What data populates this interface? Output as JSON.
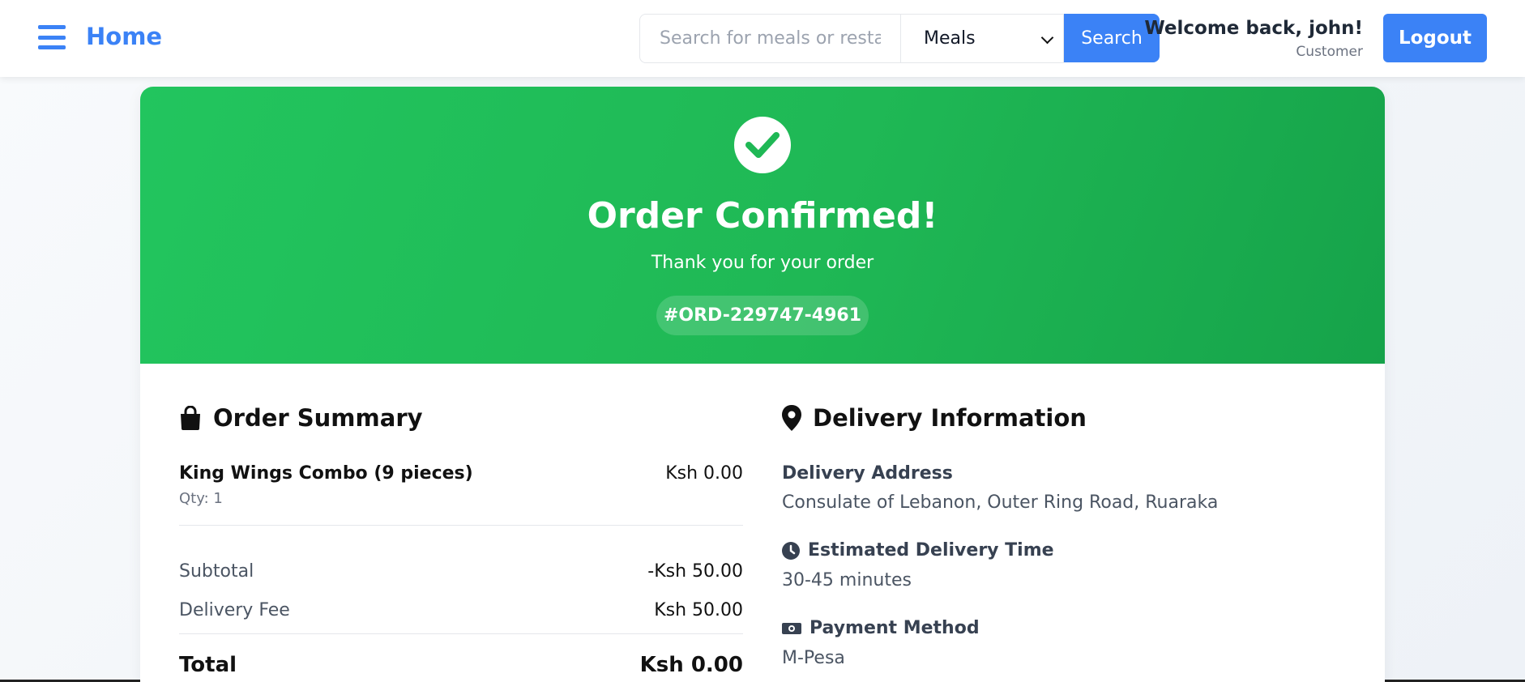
{
  "header": {
    "home_label": "Home",
    "search_placeholder": "Search for meals or restaurants",
    "category_selected": "Meals",
    "search_label": "Search",
    "welcome_text": "Welcome back, john!",
    "user_role": "Customer",
    "logout_label": "Logout"
  },
  "banner": {
    "title": "Order Confirmed!",
    "subtitle": "Thank you for your order",
    "order_number": "#ORD-229747-4961"
  },
  "order_summary": {
    "title": "Order Summary",
    "items": [
      {
        "name": "King Wings Combo (9 pieces)",
        "qty": "Qty: 1",
        "price": "Ksh 0.00"
      }
    ],
    "subtotal_label": "Subtotal",
    "subtotal_value": "-Ksh 50.00",
    "delivery_fee_label": "Delivery Fee",
    "delivery_fee_value": "Ksh 50.00",
    "total_label": "Total",
    "total_value": "Ksh 0.00"
  },
  "delivery_info": {
    "title": "Delivery Information",
    "address_label": "Delivery Address",
    "address_value": "Consulate of Lebanon, Outer Ring Road, Ruaraka",
    "time_label": "Estimated Delivery Time",
    "time_value": "30-45 minutes",
    "payment_label": "Payment Method",
    "payment_value": "M-Pesa"
  },
  "colors": {
    "accent": "#3b82f6",
    "success": "#22c55e",
    "success_dark": "#16a34a"
  },
  "icons": [
    "menu-icon",
    "chevron-down-icon",
    "check-icon",
    "shopping-bag-icon",
    "map-pin-icon",
    "clock-icon",
    "money-icon"
  ]
}
